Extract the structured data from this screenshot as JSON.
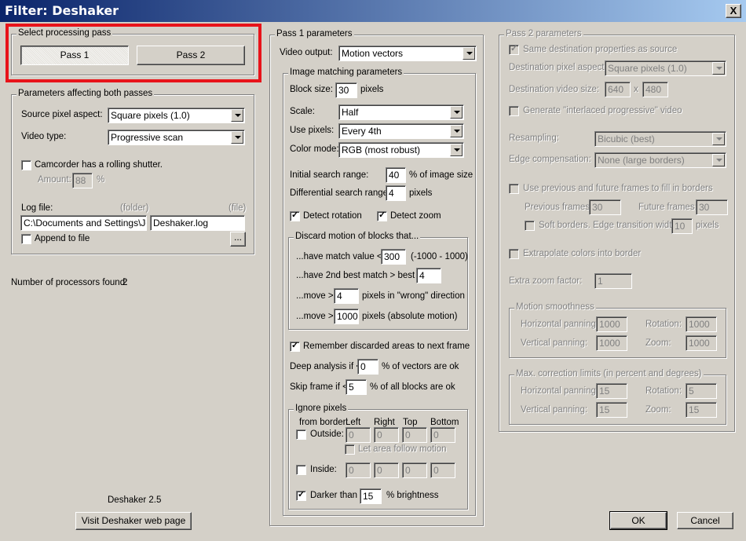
{
  "window": {
    "title": "Filter: Deshaker",
    "close": "X"
  },
  "processing_pass": {
    "group": "Select processing pass",
    "pass1": "Pass 1",
    "pass2": "Pass 2"
  },
  "both_passes": {
    "group": "Parameters affecting both passes",
    "source_pixel_aspect_label": "Source pixel aspect:",
    "source_pixel_aspect": "Square pixels (1.0)",
    "video_type_label": "Video type:",
    "video_type": "Progressive scan",
    "rolling_shutter_label": "Camcorder has a rolling shutter.",
    "amount_label": "Amount:",
    "amount_value": "88",
    "amount_unit": "%",
    "log_file_label": "Log file:",
    "folder_label": "(folder)",
    "file_label": "(file)",
    "folder_value": "C:\\Documents and Settings\\John",
    "file_value": "Deshaker.log",
    "append_label": "Append to file",
    "browse_label": "..."
  },
  "processors": {
    "label": "Number of processors found:",
    "value": "2"
  },
  "version": "Deshaker 2.5",
  "web_button": "Visit Deshaker web page",
  "pass1": {
    "group": "Pass 1 parameters",
    "video_output_label": "Video output:",
    "video_output": "Motion vectors",
    "image_matching": {
      "group": "Image matching parameters",
      "block_size_label": "Block size:",
      "block_size": "30",
      "block_size_unit": "pixels",
      "scale_label": "Scale:",
      "scale": "Half",
      "use_pixels_label": "Use pixels:",
      "use_pixels": "Every 4th",
      "color_mode_label": "Color mode:",
      "color_mode": "RGB (most robust)",
      "initial_range_label": "Initial search range:",
      "initial_range": "40",
      "initial_range_unit": "% of image size",
      "diff_range_label": "Differential search range:",
      "diff_range": "4",
      "diff_range_unit": "pixels",
      "detect_rotation": "Detect rotation",
      "detect_zoom": "Detect zoom",
      "discard": {
        "group": "Discard motion of blocks that...",
        "match_label": "...have match value <",
        "match_value": "300",
        "match_range": "(-1000 - 1000)",
        "second_label": "...have 2nd best match > best -",
        "second_value": "4",
        "move_wrong_label": "...move >",
        "move_wrong_value": "4",
        "move_wrong_unit": "pixels in \"wrong\" direction",
        "move_abs_label": "...move >",
        "move_abs_value": "1000",
        "move_abs_unit": "pixels (absolute motion)"
      },
      "remember_label": "Remember discarded areas to next frame",
      "deep_label": "Deep analysis if <",
      "deep_value": "0",
      "deep_unit": "% of vectors are ok",
      "skip_label": "Skip frame if <",
      "skip_value": "5",
      "skip_unit": "% of all blocks are ok",
      "ignore": {
        "group": "Ignore pixels",
        "from_border": "from border:",
        "cols": [
          "Left",
          "Right",
          "Top",
          "Bottom"
        ],
        "outside_label": "Outside:",
        "outside_values": [
          "0",
          "0",
          "0",
          "0"
        ],
        "follow_label": "Let area follow motion",
        "inside_label": "Inside:",
        "inside_values": [
          "0",
          "0",
          "0",
          "0"
        ],
        "darker_label": "Darker than",
        "darker_value": "15",
        "darker_unit": "% brightness"
      }
    }
  },
  "pass2": {
    "group": "Pass 2 parameters",
    "same_dest_label": "Same destination properties as source",
    "dest_aspect_label": "Destination pixel aspect:",
    "dest_aspect": "Square pixels (1.0)",
    "dest_size_label": "Destination video size:",
    "dest_width": "640",
    "dest_x": "x",
    "dest_height": "480",
    "interlaced_label": "Generate \"interlaced progressive\" video",
    "resampling_label": "Resampling:",
    "resampling": "Bicubic (best)",
    "edge_comp_label": "Edge compensation:",
    "edge_comp": "None (large borders)",
    "prev_future_label": "Use previous and future frames to fill in borders",
    "prev_frames_label": "Previous frames:",
    "prev_frames": "30",
    "future_frames_label": "Future frames:",
    "future_frames": "30",
    "soft_borders_label": "Soft borders. Edge transition width:",
    "soft_borders_value": "10",
    "soft_borders_unit": "pixels",
    "extrapolate_label": "Extrapolate colors into border",
    "extra_zoom_label": "Extra zoom factor:",
    "extra_zoom": "1",
    "smoothness": {
      "group": "Motion smoothness",
      "hpan_label": "Horizontal panning:",
      "hpan": "1000",
      "rot_label": "Rotation:",
      "rot": "1000",
      "vpan_label": "Vertical panning:",
      "vpan": "1000",
      "zoom_label": "Zoom:",
      "zoom": "1000"
    },
    "limits": {
      "group": "Max. correction limits (in percent and degrees)",
      "hpan_label": "Horizontal panning:",
      "hpan": "15",
      "rot_label": "Rotation:",
      "rot": "5",
      "vpan_label": "Vertical panning:",
      "vpan": "15",
      "zoom_label": "Zoom:",
      "zoom": "15"
    }
  },
  "footer": {
    "ok": "OK",
    "cancel": "Cancel"
  },
  "colors": {
    "titlebar_start": "#0a246a",
    "titlebar_end": "#a6caf0",
    "highlight": "#e8131a",
    "face": "#d4d0c8"
  }
}
